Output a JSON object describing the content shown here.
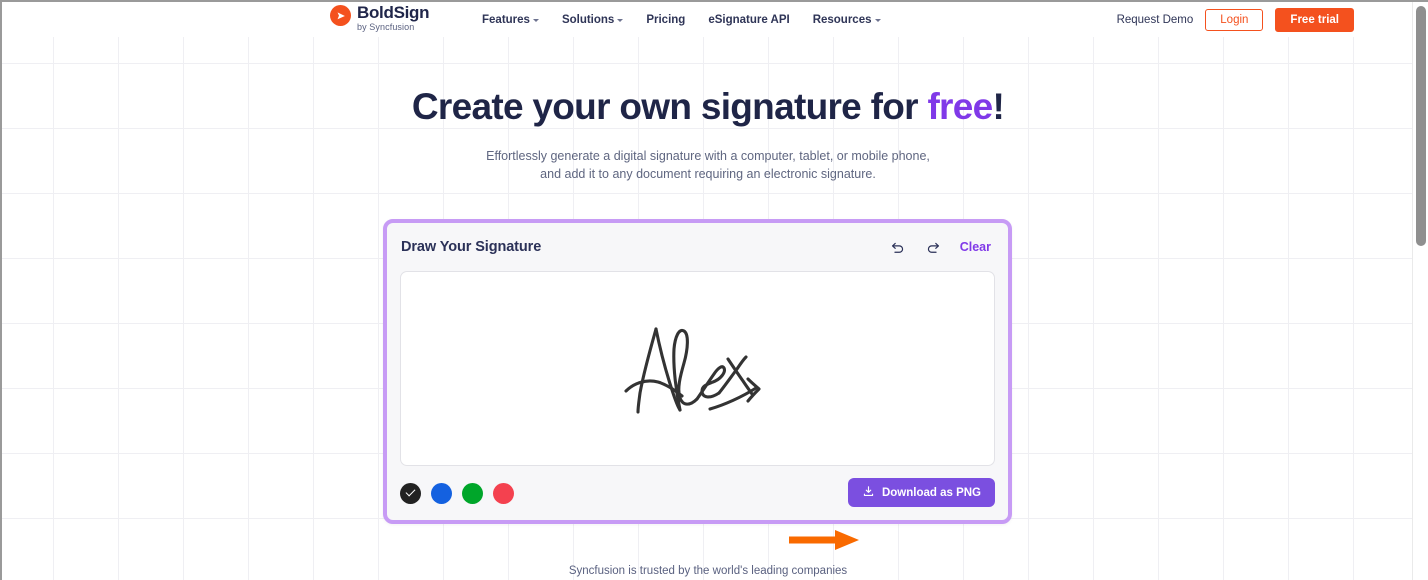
{
  "nav": {
    "brand": {
      "name": "BoldSign",
      "tagline": "by Syncfusion",
      "icon": "paper-plane-icon"
    },
    "links": [
      {
        "label": "Features",
        "has_caret": true
      },
      {
        "label": "Solutions",
        "has_caret": true
      },
      {
        "label": "Pricing",
        "has_caret": false
      },
      {
        "label": "eSignature API",
        "has_caret": false
      },
      {
        "label": "Resources",
        "has_caret": true
      }
    ],
    "request_demo": "Request Demo",
    "login": "Login",
    "free_trial": "Free trial"
  },
  "hero": {
    "headline_pre": "Create your own signature for ",
    "headline_accent": "free",
    "headline_post": "!",
    "subtitle_line1": "Effortlessly generate a digital signature with a computer, tablet, or mobile phone,",
    "subtitle_line2": "and add it to any document requiring an electronic signature."
  },
  "signature_card": {
    "title": "Draw Your Signature",
    "undo_icon": "undo-icon",
    "redo_icon": "redo-icon",
    "clear_label": "Clear",
    "canvas": {
      "drawn_text": "Alex",
      "ink_color": "#333333"
    },
    "colors": [
      {
        "name": "black",
        "hex": "#222222",
        "selected": true
      },
      {
        "name": "blue",
        "hex": "#1461E0",
        "selected": false
      },
      {
        "name": "green",
        "hex": "#00A62A",
        "selected": false
      },
      {
        "name": "red",
        "hex": "#F4414F",
        "selected": false
      }
    ],
    "download_label": "Download as PNG",
    "download_icon": "download-icon",
    "accent_color": "#7B4FE0",
    "border_color": "#c79bf5"
  },
  "annotation": {
    "type": "arrow-right",
    "color": "#F96A00",
    "points_to": "Download as PNG"
  },
  "footer": {
    "trusted_text": "Syncfusion is trusted by the world's leading companies"
  },
  "scrollbar": {
    "orientation": "vertical",
    "thumb_position_percent": 0
  }
}
